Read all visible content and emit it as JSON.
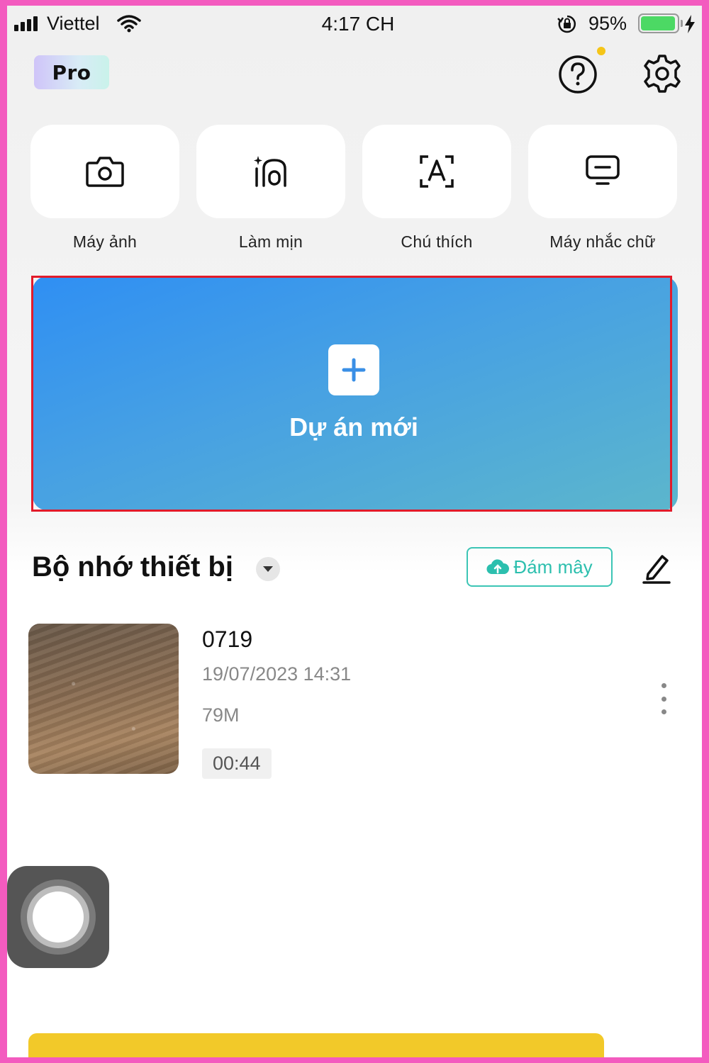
{
  "status_bar": {
    "carrier": "Viettel",
    "time": "4:17 CH",
    "battery_percent": "95%",
    "battery_level": 0.95,
    "icons": [
      "signal-icon",
      "wifi-icon",
      "rotation-lock-icon",
      "battery-icon",
      "charging-icon"
    ]
  },
  "header": {
    "pro_badge": "Pro",
    "help_icon": "help-icon",
    "settings_icon": "gear-icon",
    "notification_dot_color": "#f5c518"
  },
  "tools": [
    {
      "label": "Máy ảnh",
      "icon": "camera-icon"
    },
    {
      "label": "Làm mịn",
      "icon": "retouch-icon"
    },
    {
      "label": "Chú thích",
      "icon": "auto-caption-icon"
    },
    {
      "label": "Máy nhắc chữ",
      "icon": "teleprompter-icon"
    }
  ],
  "new_project": {
    "label": "Dự án mới",
    "icon": "plus-icon",
    "gradient_colors": [
      "#2f8ff3",
      "#5cb6cc"
    ],
    "highlight_color": "#e21b2a"
  },
  "storage": {
    "title": "Bộ nhớ thiết bị",
    "cloud_button": "Đám mây",
    "accent_color": "#2cbfae"
  },
  "projects": [
    {
      "name": "0719",
      "date": "19/07/2023 14:31",
      "size": "79M",
      "duration": "00:44"
    }
  ],
  "colors": {
    "frame_border": "#f35bbf",
    "bottom_banner": "#f2c929"
  }
}
